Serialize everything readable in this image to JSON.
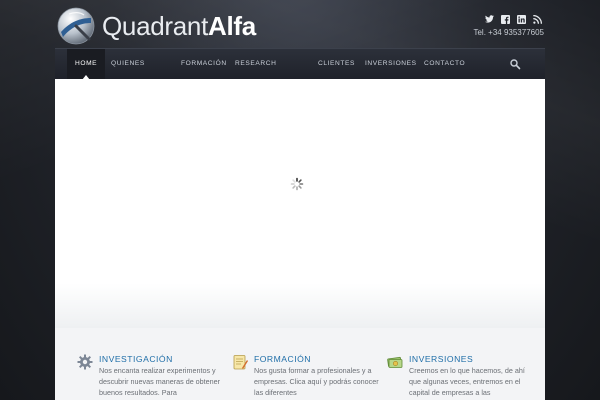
{
  "header": {
    "logo_text_light": "Quadrant",
    "logo_text_bold": "Alfa",
    "phone": "Tel. +34 935377605",
    "social_icons": [
      "twitter-icon",
      "facebook-icon",
      "linkedin-icon",
      "rss-icon"
    ]
  },
  "nav": {
    "items": [
      {
        "label": "HOME",
        "active": true
      },
      {
        "label": "QUIENES"
      },
      {
        "label": "FORMACIÓN"
      },
      {
        "label": "RESEARCH"
      },
      {
        "label": "CLIENTES"
      },
      {
        "label": "INVERSIONES"
      },
      {
        "label": "CONTACTO"
      }
    ],
    "search_icon": "search-icon"
  },
  "slider": {
    "state_icon": "loading-spinner-icon"
  },
  "features": [
    {
      "icon": "gear-icon",
      "title": "INVESTIGACIÓN",
      "text": "Nos encanta realizar experimentos y descubrir nuevas maneras de obtener buenos resultados. Para"
    },
    {
      "icon": "notepad-icon",
      "title": "FORMACIÓN",
      "text": "Nos gusta formar a profesionales y a empresas. Clica aquí y podrás conocer las diferentes"
    },
    {
      "icon": "money-icon",
      "title": "INVERSIONES",
      "text": "Creemos en lo que hacemos, de ahí que algunas veces, entremos en el capital de empresas a las"
    }
  ],
  "colors": {
    "accent": "#1f6ea8",
    "nav_bg": "#23262d",
    "page_bg": "#1b1d22"
  }
}
